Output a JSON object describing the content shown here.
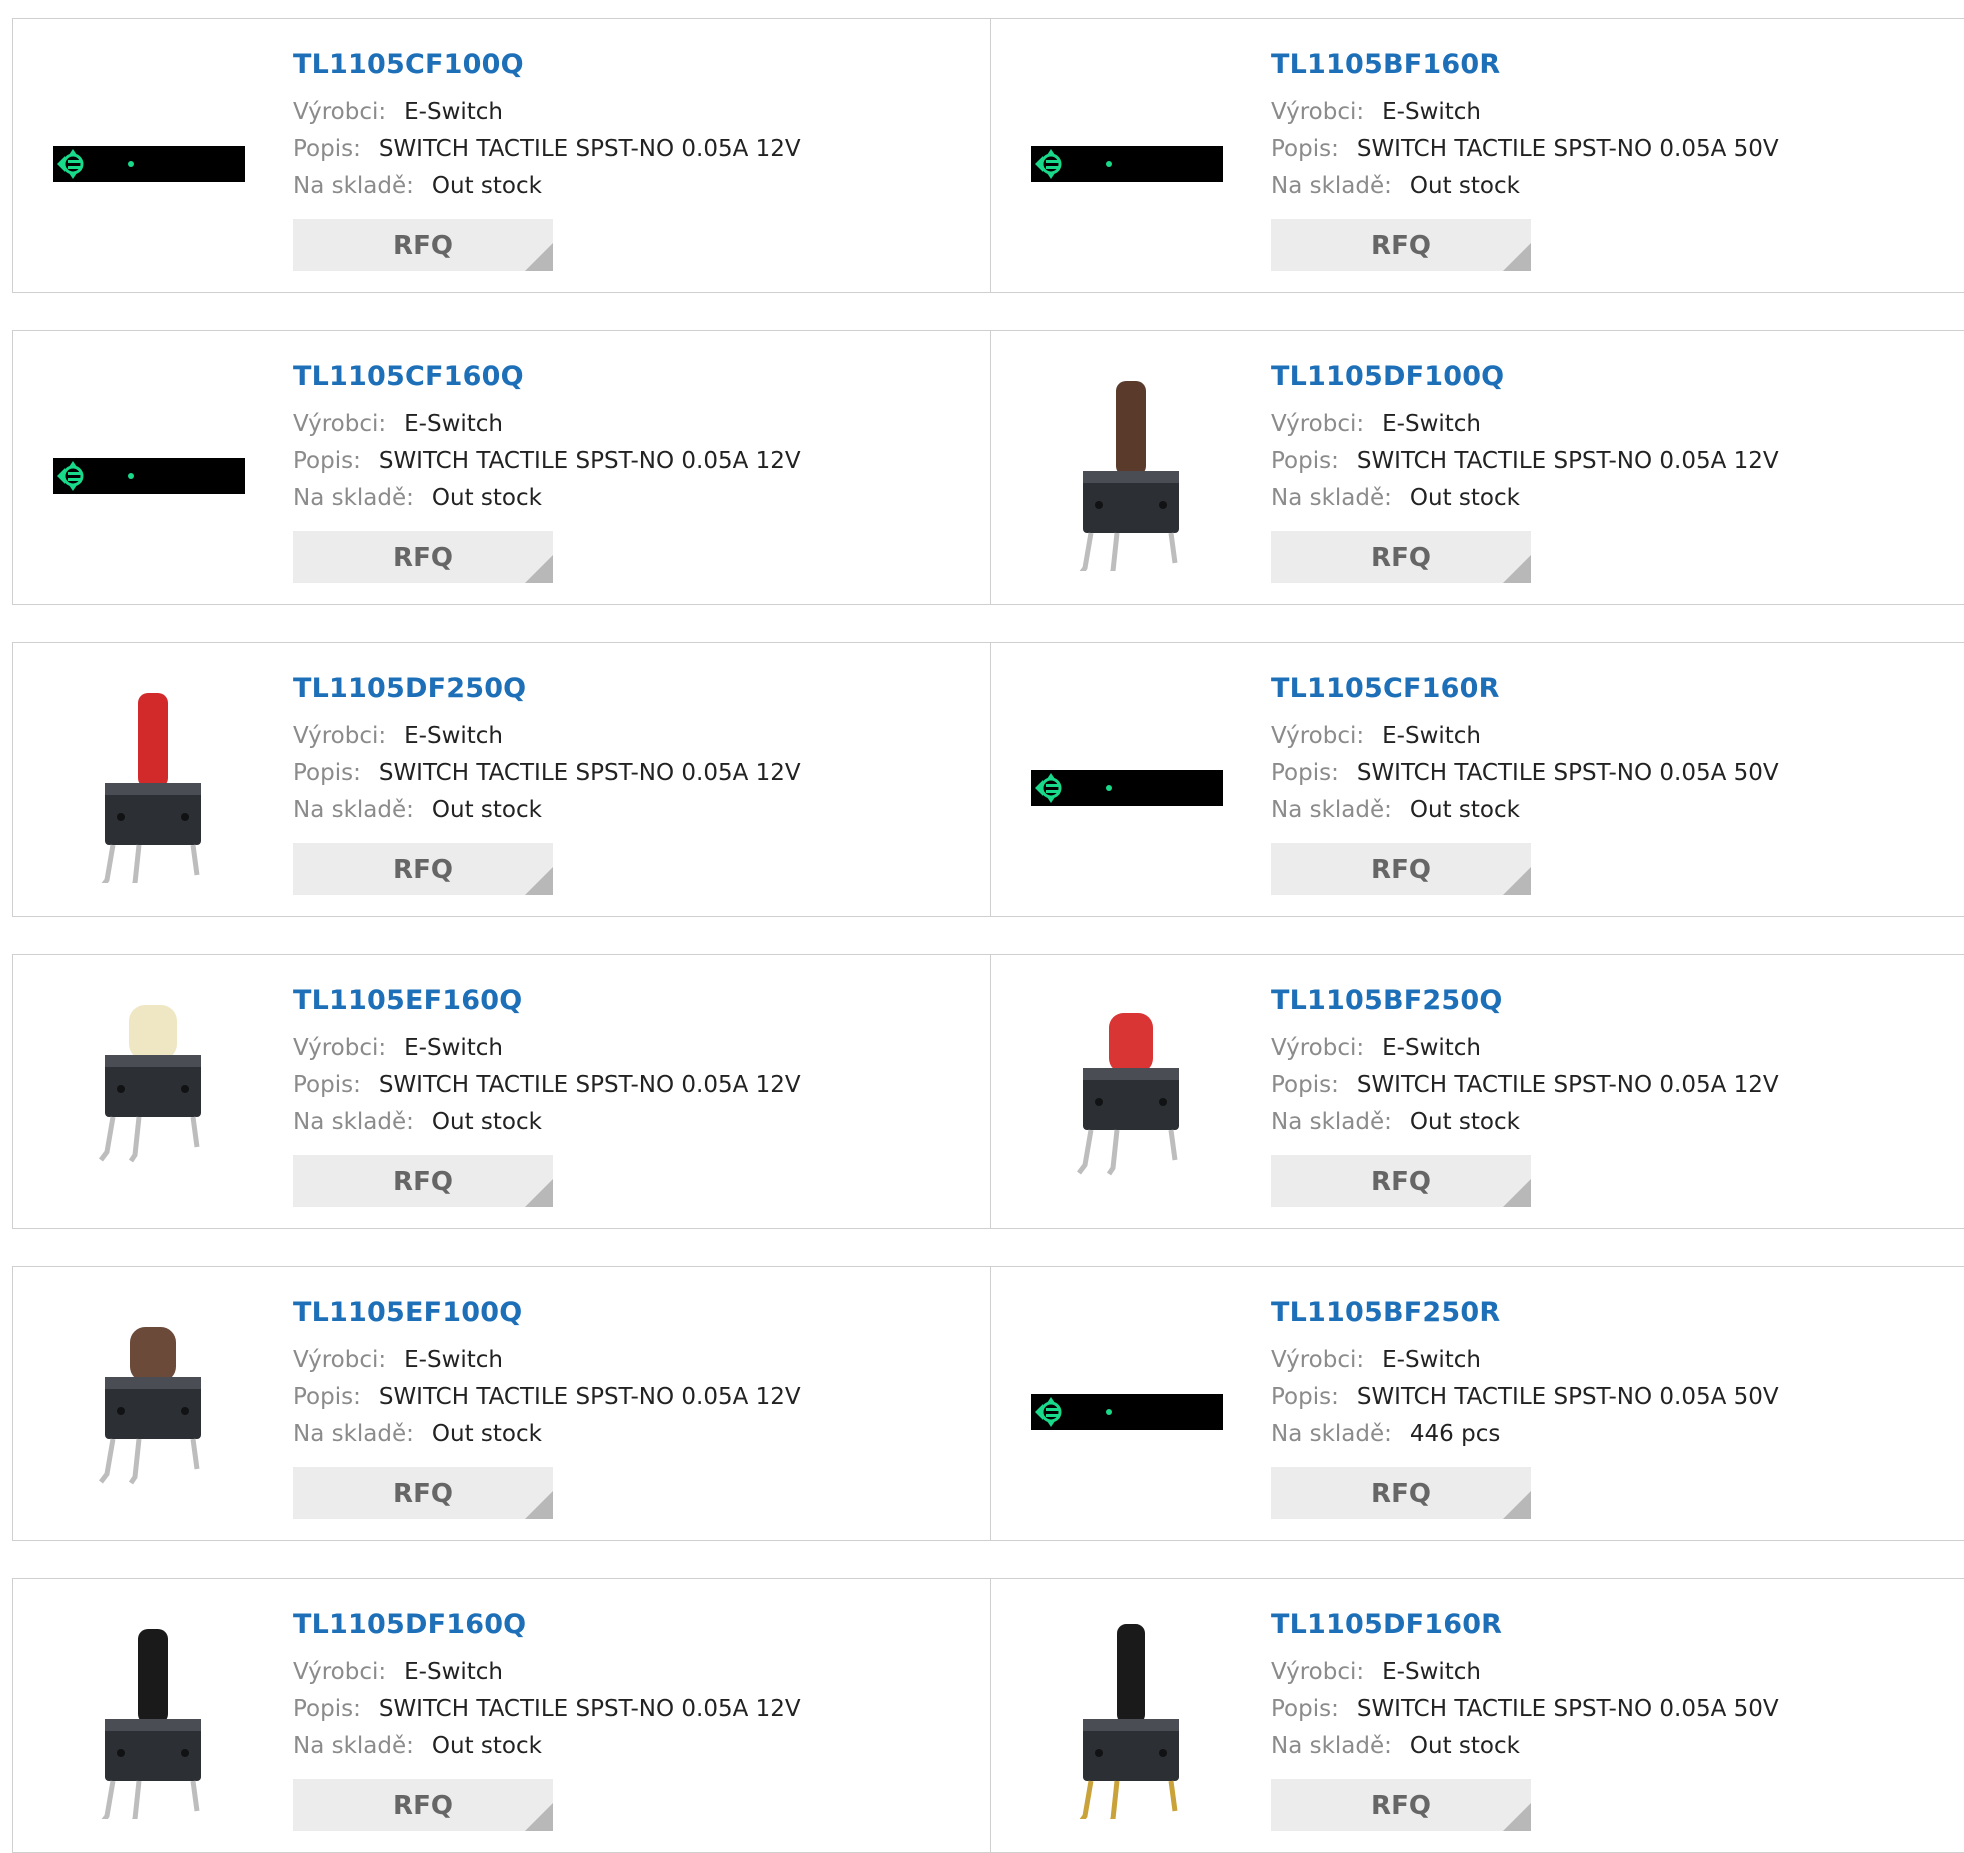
{
  "labels": {
    "manufacturer": "Výrobci:",
    "description": "Popis:",
    "stock": "Na skladě:",
    "rfq": "RFQ"
  },
  "colors": {
    "title": "#1d6fb8",
    "label": "#8b8b8b",
    "button_bg": "#ececec",
    "placeholder_icon": "#19d98a"
  },
  "products": [
    {
      "part": "TL1105CF100Q",
      "manufacturer": "E-Switch",
      "description": "SWITCH TACTILE SPST-NO 0.05A 12V",
      "stock": "Out stock",
      "image": "placeholder-image"
    },
    {
      "part": "TL1105BF160R",
      "manufacturer": "E-Switch",
      "description": "SWITCH TACTILE SPST-NO 0.05A 50V",
      "stock": "Out stock",
      "image": "placeholder-image"
    },
    {
      "part": "TL1105CF160Q",
      "manufacturer": "E-Switch",
      "description": "SWITCH TACTILE SPST-NO 0.05A 12V",
      "stock": "Out stock",
      "image": "placeholder-image"
    },
    {
      "part": "TL1105DF100Q",
      "manufacturer": "E-Switch",
      "description": "SWITCH TACTILE SPST-NO 0.05A 12V",
      "stock": "Out stock",
      "image": "tall-brown-switch"
    },
    {
      "part": "TL1105DF250Q",
      "manufacturer": "E-Switch",
      "description": "SWITCH TACTILE SPST-NO 0.05A 12V",
      "stock": "Out stock",
      "image": "tall-red-switch"
    },
    {
      "part": "TL1105CF160R",
      "manufacturer": "E-Switch",
      "description": "SWITCH TACTILE SPST-NO 0.05A 50V",
      "stock": "Out stock",
      "image": "placeholder-image"
    },
    {
      "part": "TL1105EF160Q",
      "manufacturer": "E-Switch",
      "description": "SWITCH TACTILE SPST-NO 0.05A 12V",
      "stock": "Out stock",
      "image": "short-ivory-switch"
    },
    {
      "part": "TL1105BF250Q",
      "manufacturer": "E-Switch",
      "description": "SWITCH TACTILE SPST-NO 0.05A 12V",
      "stock": "Out stock",
      "image": "medium-red-switch"
    },
    {
      "part": "TL1105EF100Q",
      "manufacturer": "E-Switch",
      "description": "SWITCH TACTILE SPST-NO 0.05A 12V",
      "stock": "Out stock",
      "image": "short-brown-switch"
    },
    {
      "part": "TL1105BF250R",
      "manufacturer": "E-Switch",
      "description": "SWITCH TACTILE SPST-NO 0.05A 50V",
      "stock": "446 pcs",
      "image": "placeholder-image"
    },
    {
      "part": "TL1105DF160Q",
      "manufacturer": "E-Switch",
      "description": "SWITCH TACTILE SPST-NO 0.05A 12V",
      "stock": "Out stock",
      "image": "tall-black-switch"
    },
    {
      "part": "TL1105DF160R",
      "manufacturer": "E-Switch",
      "description": "SWITCH TACTILE SPST-NO 0.05A 50V",
      "stock": "Out stock",
      "image": "tall-black-gold-switch"
    }
  ]
}
